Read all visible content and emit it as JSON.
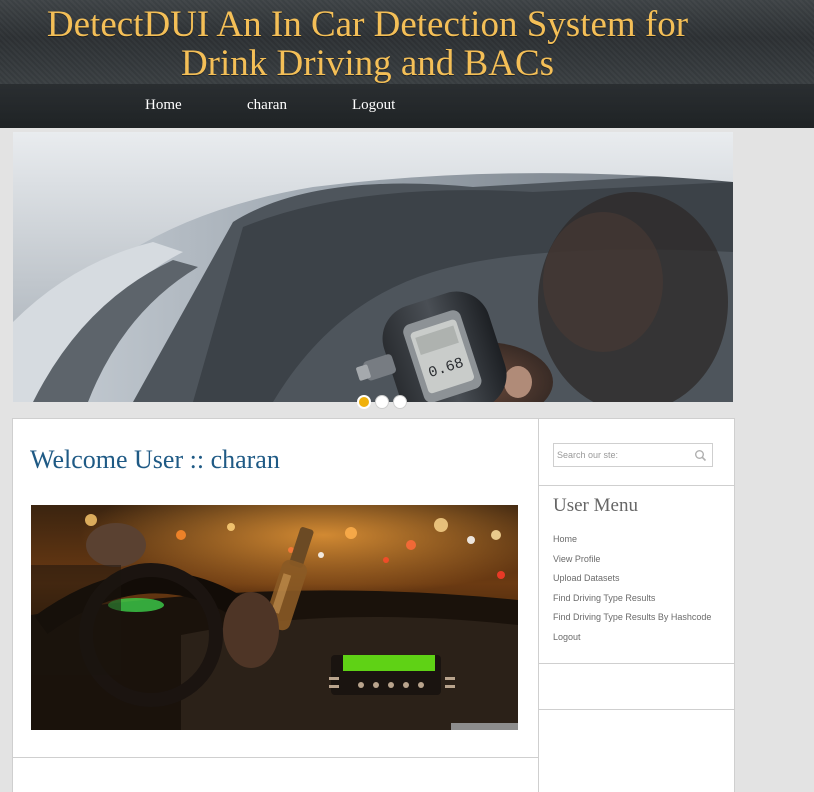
{
  "header": {
    "title_line1": "DetectDUI An In Car Detection System for",
    "title_line2": "Drink Driving and BACs"
  },
  "nav": {
    "items": [
      {
        "label": "Home"
      },
      {
        "label": "charan"
      },
      {
        "label": "Logout"
      }
    ]
  },
  "banner": {
    "breathalyzer_reading": "0.68",
    "slides": 3,
    "active_slide": 1
  },
  "main": {
    "welcome": "Welcome User :: charan"
  },
  "sidebar": {
    "search_placeholder": "Search our ste:",
    "search_icon": "magnifier-icon",
    "menu_title": "User Menu",
    "menu_items": [
      {
        "label": "Home"
      },
      {
        "label": "View Profile"
      },
      {
        "label": "Upload Datasets"
      },
      {
        "label": "Find Driving Type Results"
      },
      {
        "label": "Find Driving Type Results By Hashcode"
      },
      {
        "label": "Logout"
      }
    ]
  },
  "colors": {
    "title_gold": "#f4bf57",
    "header_dark": "#2d3134",
    "welcome_blue": "#1f5a85",
    "active_dot": "#f0b10c",
    "page_bg": "#e3e3e3"
  }
}
